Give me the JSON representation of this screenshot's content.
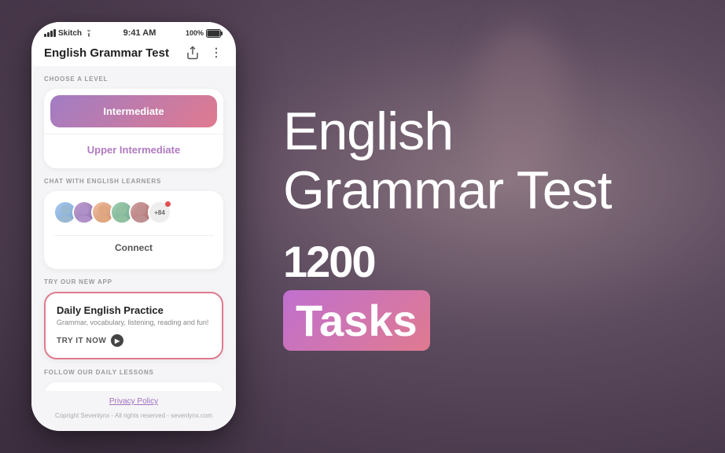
{
  "background": {
    "color": "#6b5a6e"
  },
  "phone": {
    "statusBar": {
      "carrier": "Skitch",
      "time": "9:41 AM",
      "battery": "100%"
    },
    "header": {
      "title": "English Grammar Test",
      "shareIcon": "share-icon",
      "menuIcon": "menu-icon"
    },
    "sections": {
      "level": {
        "label": "CHOOSE A LEVEL",
        "buttons": [
          {
            "text": "Intermediate",
            "style": "active"
          },
          {
            "text": "Upper Intermediate",
            "style": "inactive"
          }
        ]
      },
      "chat": {
        "label": "CHAT WITH ENGLISH LEARNERS",
        "avatarCount": "+84",
        "connectButton": "Connect"
      },
      "newApp": {
        "label": "TRY OUR NEW APP",
        "title": "Daily English Practice",
        "subtitle": "Grammar, vocabulary, listening, reading and fun!",
        "tryButton": "TRY IT NOW"
      },
      "social": {
        "label": "FOLLOW OUR DAILY LESSONS",
        "icons": [
          "instagram",
          "telegram",
          "facebook"
        ]
      }
    },
    "footer": {
      "privacyLink": "Privacy Policy",
      "copyright": "Copright Sevenlynx - All rights reserved - sevenlynx.com"
    }
  },
  "rightSide": {
    "titleLine1": "English",
    "titleLine2": "Grammar Test",
    "number": "1200",
    "tasksLabel": "Tasks"
  }
}
